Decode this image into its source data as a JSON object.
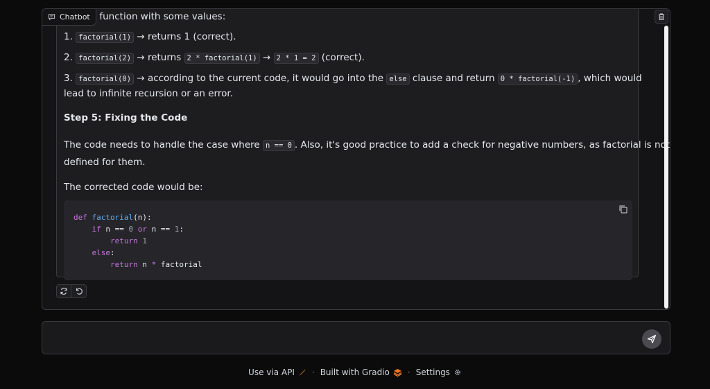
{
  "chatbot": {
    "label": "Chatbot"
  },
  "message": {
    "intro": "est the function with some values:",
    "item1": {
      "num": "1.",
      "code": "factorial(1)",
      "text": " → returns 1 (correct)."
    },
    "item2": {
      "num": "2.",
      "code": "factorial(2)",
      "text1": " → returns ",
      "code2": "2 * factorial(1)",
      "text2": " → ",
      "code3": "2 * 1 = 2",
      "text3": " (correct)."
    },
    "item3": {
      "num": "3.",
      "code": "factorial(0)",
      "text1": " → according to the current code, it would go into the ",
      "code2": "else",
      "text2": " clause and return ",
      "code3": "0 * factorial(-1)",
      "text3": ", which would",
      "line2": "lead to infinite recursion or an error."
    },
    "step5_heading": "Step 5: Fixing the Code",
    "fix_text1": "The code needs to handle the case where ",
    "fix_code": "n == 0",
    "fix_text2": ". Also, it's good practice to add a check for negative numbers, as factorial is not",
    "fix_line2": "defined for them.",
    "corrected_intro": "The corrected code would be:",
    "code_lines": {
      "l1_kw": "def",
      "l1_fn": "factorial",
      "l1_rest": "(n):",
      "l2_kw1": "if",
      "l2_a": " n == ",
      "l2_n0": "0",
      "l2_kw2": " or",
      "l2_b": " n == ",
      "l2_n1": "1",
      "l2_c": ":",
      "l3_kw": "return",
      "l3_n": " 1",
      "l4_kw": "else",
      "l4_c": ":",
      "l5_kw": "return",
      "l5_rest": " n ",
      "l5_op": "*",
      "l5_fn": " factorial"
    }
  },
  "input": {
    "placeholder": "",
    "value": ""
  },
  "footer": {
    "api": "Use via API",
    "gradio": "Built with Gradio",
    "settings": "Settings",
    "separator": "·"
  }
}
